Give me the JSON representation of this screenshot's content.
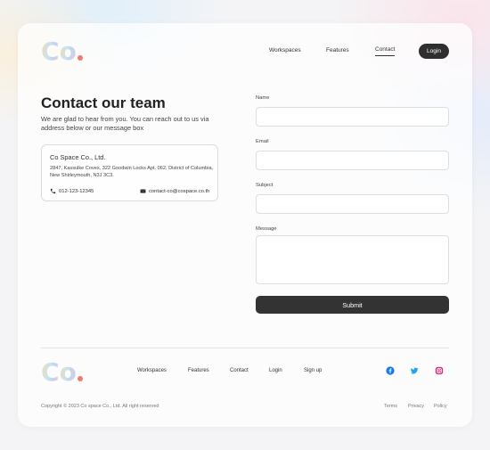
{
  "header": {
    "logo": {
      "letters": [
        "C",
        "o"
      ]
    },
    "nav": [
      {
        "label": "Workspaces"
      },
      {
        "label": "Features"
      },
      {
        "label": "Contact",
        "active": true
      }
    ],
    "login_label": "Login"
  },
  "contact": {
    "heading": "Contact our team",
    "intro": "We are glad to hear from you. You can reach out to us via address below or our message box",
    "company": "Co Space Co., Ltd.",
    "address": "2847,  Kassulke Coves,  322 Goodwin Locks Apt. 062, District of Columbia, New Shirleymouth, N3J 3C3.",
    "phone": "012-123-12345",
    "email": "contact-co@cospace.co.th"
  },
  "form": {
    "name_label": "Name",
    "email_label": "Email",
    "subject_label": "Subject",
    "message_label": "Message",
    "name_value": "",
    "email_value": "",
    "subject_value": "",
    "message_value": "",
    "submit_label": "Submit"
  },
  "footer": {
    "nav": [
      {
        "label": "Workspaces"
      },
      {
        "label": "Features"
      },
      {
        "label": "Contact"
      },
      {
        "label": "Login"
      },
      {
        "label": "Sign up"
      }
    ],
    "social": [
      "facebook-icon",
      "twitter-icon",
      "instagram-icon"
    ],
    "copyright": "Copyright © 2023 Co space Co., Ltd.  All right reserved",
    "legal": [
      {
        "label": "Terms"
      },
      {
        "label": "Privacy"
      },
      {
        "label": "Policy"
      }
    ]
  },
  "colors": {
    "primary_dark": "#2f2f2f",
    "logo_dot": "#f07b6c",
    "facebook": "#1877f2",
    "twitter": "#1da1f2",
    "instagram": "#d62976"
  }
}
